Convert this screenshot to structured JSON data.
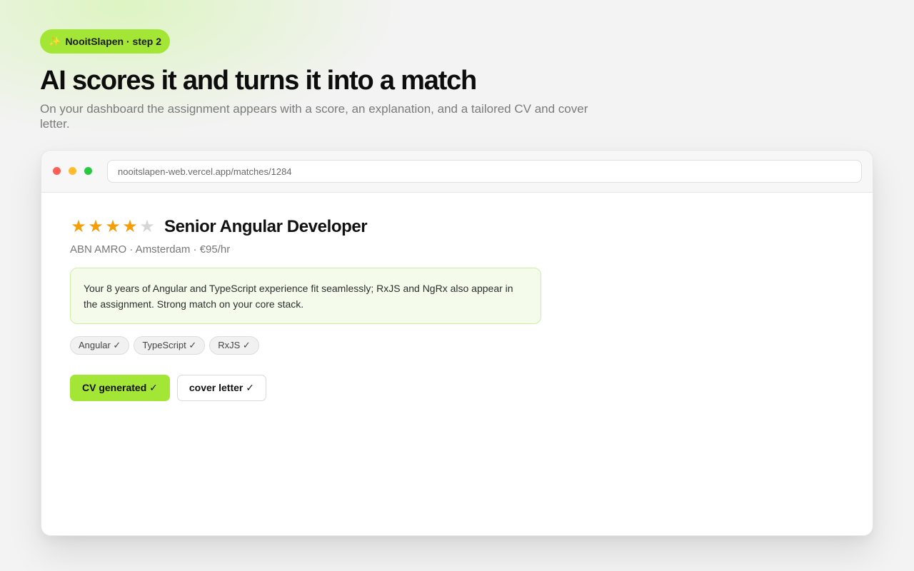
{
  "badge": {
    "icon": "sparkles-icon",
    "icon_glyph": "✨",
    "label": "NooitSlapen · step 2"
  },
  "headline": "AI scores it and turns it into a match",
  "subline": "On your dashboard the assignment appears with a score, an explanation, and a tailored CV and cover letter.",
  "browser": {
    "url": "nooitslapen-web.vercel.app/matches/1284"
  },
  "match": {
    "rating": 4,
    "rating_max": 5,
    "title": "Senior Angular Developer",
    "meta": "ABN AMRO · Amsterdam · €95/hr",
    "explanation": "Your 8 years of Angular and TypeScript experience fit seamlessly; RxJS and NgRx also appear in the assignment. Strong match on your core stack.",
    "tags": [
      "Angular ✓",
      "TypeScript ✓",
      "RxJS ✓"
    ],
    "actions": {
      "cv": "CV generated ✓",
      "cover": "cover letter ✓"
    }
  },
  "colors": {
    "accent": "#a3e635",
    "star": "#f59e0b",
    "star_empty": "#d6d6d6"
  }
}
